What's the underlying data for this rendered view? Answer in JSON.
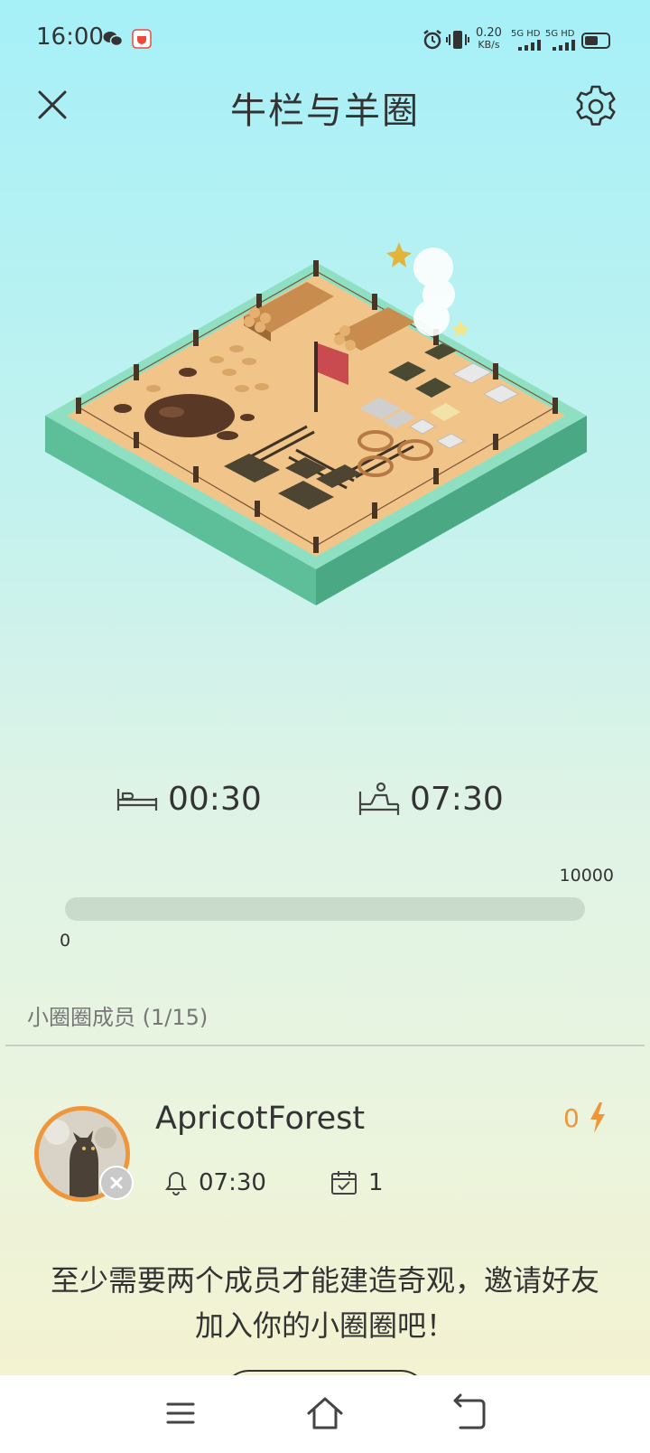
{
  "status_bar": {
    "time": "16:00",
    "net_speed_value": "0.20",
    "net_speed_unit": "KB/s",
    "sim1": "5G HD",
    "sim2": "5G HD",
    "icons": [
      "wechat-icon",
      "app-notification-icon",
      "alarm-icon",
      "vibrate-icon",
      "signal-icon",
      "battery-icon"
    ]
  },
  "header": {
    "title": "牛栏与羊圈",
    "close_icon": "close-icon",
    "settings_icon": "gear-icon"
  },
  "schedule": {
    "sleep_time": "00:30",
    "wake_time": "07:30",
    "sleep_icon": "bed-icon",
    "wake_icon": "wake-up-icon"
  },
  "progress": {
    "min": "0",
    "max": "10000",
    "value_fraction": 0
  },
  "members": {
    "heading": "小圈圈成员",
    "count": "(1/15)",
    "list": [
      {
        "name": "ApricotForest",
        "energy": "0",
        "alarm_time": "07:30",
        "checkin_days": "1"
      }
    ]
  },
  "notice": {
    "line1": "至少需要两个成员才能建造奇观，邀请好友",
    "line2": "加入你的小圈圈吧！"
  },
  "colors": {
    "accent_orange": "#f0963a",
    "progress_track": "#c9dccb",
    "ground": "#f1c58a",
    "base_green": "#5cbf9a"
  },
  "nav": {
    "icons": [
      "menu-icon",
      "home-icon",
      "back-icon"
    ]
  }
}
